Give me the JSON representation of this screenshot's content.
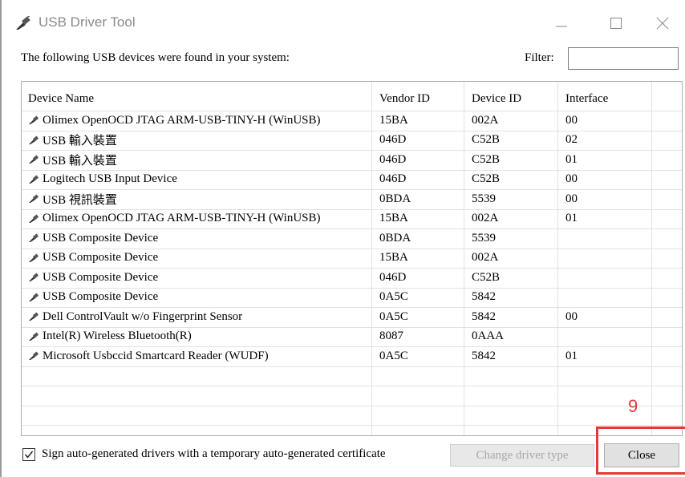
{
  "window": {
    "title": "USB Driver Tool"
  },
  "prompt": "The following USB devices were found in your system:",
  "filter": {
    "label": "Filter:",
    "value": ""
  },
  "columns": [
    "Device Name",
    "Vendor ID",
    "Device ID",
    "Interface"
  ],
  "rows": [
    {
      "name": "Olimex OpenOCD JTAG ARM-USB-TINY-H (WinUSB)",
      "vendor": "15BA",
      "device": "002A",
      "iface": "00"
    },
    {
      "name": "USB 輸入裝置",
      "vendor": "046D",
      "device": "C52B",
      "iface": "02"
    },
    {
      "name": "USB 輸入裝置",
      "vendor": "046D",
      "device": "C52B",
      "iface": "01"
    },
    {
      "name": "Logitech USB Input Device",
      "vendor": "046D",
      "device": "C52B",
      "iface": "00"
    },
    {
      "name": "USB 視訊裝置",
      "vendor": "0BDA",
      "device": "5539",
      "iface": "00"
    },
    {
      "name": "Olimex OpenOCD JTAG ARM-USB-TINY-H (WinUSB)",
      "vendor": "15BA",
      "device": "002A",
      "iface": "01"
    },
    {
      "name": "USB Composite Device",
      "vendor": "0BDA",
      "device": "5539",
      "iface": ""
    },
    {
      "name": "USB Composite Device",
      "vendor": "15BA",
      "device": "002A",
      "iface": ""
    },
    {
      "name": "USB Composite Device",
      "vendor": "046D",
      "device": "C52B",
      "iface": ""
    },
    {
      "name": "USB Composite Device",
      "vendor": "0A5C",
      "device": "5842",
      "iface": ""
    },
    {
      "name": "Dell ControlVault w/o Fingerprint Sensor",
      "vendor": "0A5C",
      "device": "5842",
      "iface": "00"
    },
    {
      "name": "Intel(R) Wireless Bluetooth(R)",
      "vendor": "8087",
      "device": "0AAA",
      "iface": ""
    },
    {
      "name": "Microsoft Usbccid Smartcard Reader (WUDF)",
      "vendor": "0A5C",
      "device": "5842",
      "iface": "01"
    }
  ],
  "checkbox": {
    "label": "Sign auto-generated drivers with a temporary auto-generated certificate",
    "checked": true
  },
  "buttons": {
    "change_driver": "Change driver type",
    "close": "Close"
  },
  "annotation": {
    "number": "9",
    "color": "#e53935"
  },
  "icons": [
    "usb-plug-icon",
    "minimize-icon",
    "maximize-icon",
    "close-icon",
    "checkmark-icon"
  ]
}
